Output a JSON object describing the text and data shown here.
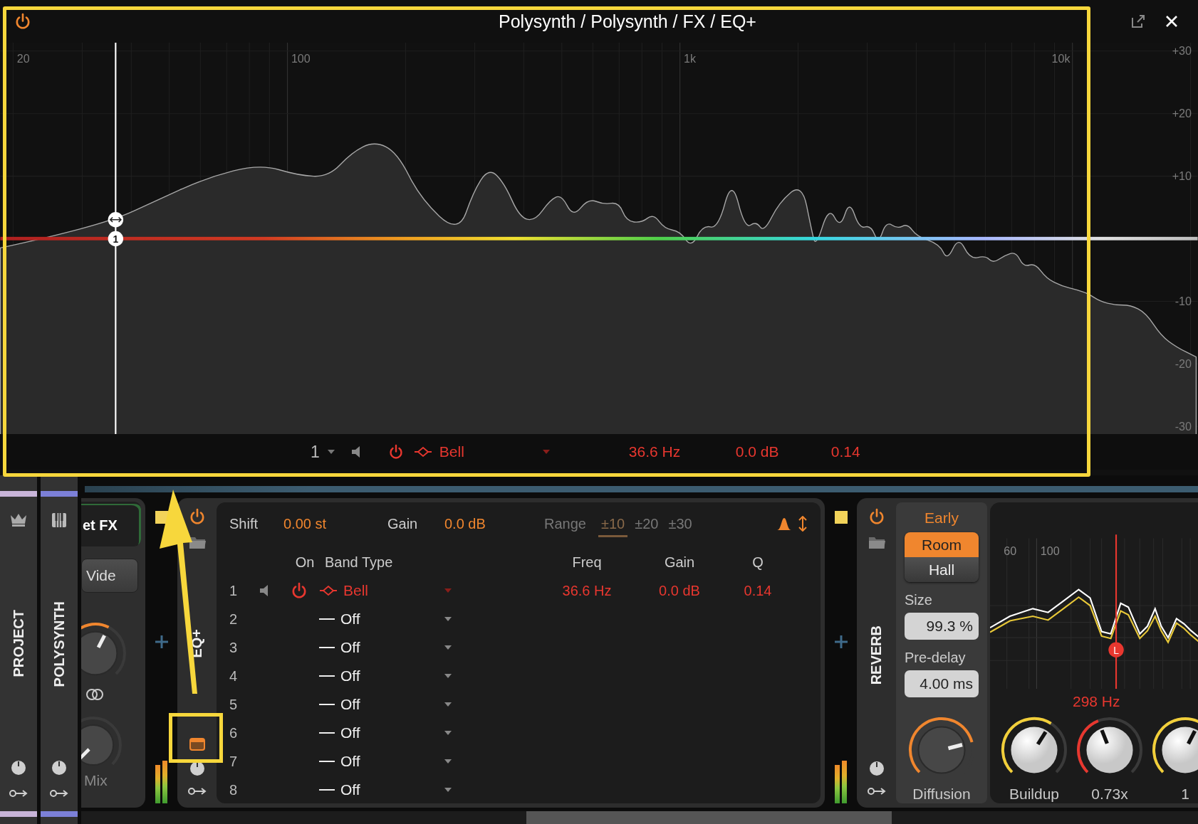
{
  "window": {
    "title": "Polysynth / Polysynth / FX / EQ+",
    "power_on": true
  },
  "graph": {
    "handle": "1",
    "freq_labels": [
      "20",
      "100",
      "1k",
      "10k"
    ],
    "db_labels": [
      "+30",
      "+20",
      "+10",
      "-10",
      "-20",
      "-30"
    ]
  },
  "footer": {
    "band": "1",
    "on": true,
    "kind": "bell",
    "type": "Bell",
    "freq": "36.6 Hz",
    "gain": "0.0 dB",
    "q": "0.14"
  },
  "tracks": [
    {
      "name": "PROJECT",
      "kind": "project",
      "color": "#c8b4d8"
    },
    {
      "name": "POLYSYNTH",
      "kind": "instrument",
      "color": "#7c80d8"
    }
  ],
  "prev_device": {
    "title": "et FX",
    "button": "Vide",
    "mix_label": "Mix"
  },
  "eq": {
    "name": "EQ+",
    "on": true,
    "shift_label": "Shift",
    "shift": "0.00 st",
    "gain_label": "Gain",
    "gain": "0.0 dB",
    "range_label": "Range",
    "ranges": [
      {
        "label": "±10",
        "selected": true
      },
      {
        "label": "±20",
        "selected": false
      },
      {
        "label": "±30",
        "selected": false
      }
    ],
    "columns": [
      "On",
      "Band Type",
      "Freq",
      "Gain",
      "Q"
    ],
    "bands": [
      {
        "number": "1",
        "on": true,
        "kind": "bell",
        "type": "Bell",
        "freq": "36.6 Hz",
        "gain": "0.0 dB",
        "q": "0.14"
      },
      {
        "number": "2",
        "on": false,
        "kind": "off",
        "type": "Off"
      },
      {
        "number": "3",
        "on": false,
        "kind": "off",
        "type": "Off"
      },
      {
        "number": "4",
        "on": false,
        "kind": "off",
        "type": "Off"
      },
      {
        "number": "5",
        "on": false,
        "kind": "off",
        "type": "Off"
      },
      {
        "number": "6",
        "on": false,
        "kind": "off",
        "type": "Off"
      },
      {
        "number": "7",
        "on": false,
        "kind": "off",
        "type": "Off"
      },
      {
        "number": "8",
        "on": false,
        "kind": "off",
        "type": "Off"
      }
    ]
  },
  "reverb": {
    "name": "REVERB",
    "on": true,
    "section": "Early",
    "modes": [
      {
        "label": "Room",
        "selected": true
      },
      {
        "label": "Hall",
        "selected": false
      }
    ],
    "size_label": "Size",
    "size": "99.3 %",
    "predelay_label": "Pre-delay",
    "predelay": "4.00 ms",
    "diffusion_label": "Diffusion",
    "graph_labels": [
      "60",
      "100"
    ],
    "marker": "L",
    "freq": "298 Hz",
    "knobs": [
      {
        "label": "Buildup"
      },
      {
        "label": "0.73x"
      },
      {
        "label": "1"
      }
    ]
  }
}
